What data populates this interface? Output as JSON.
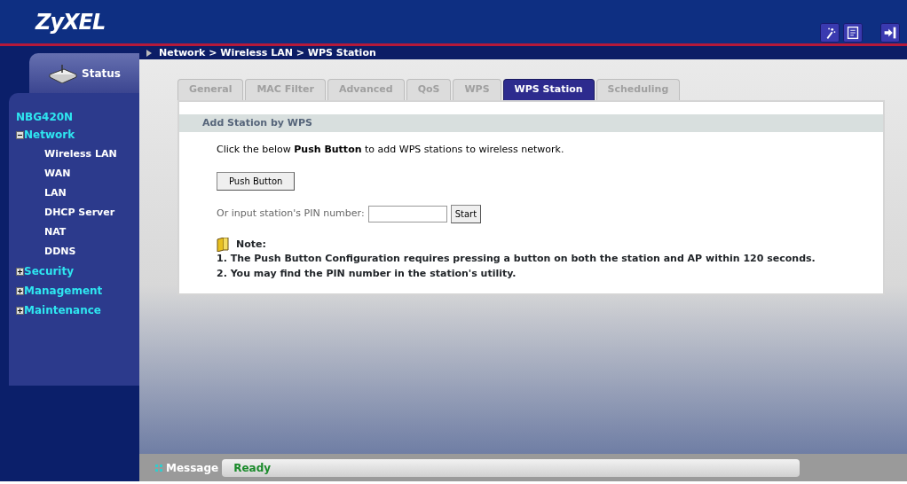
{
  "header": {
    "logo": "ZyXEL"
  },
  "sidebar": {
    "status_tab": "Status",
    "device": "NBG420N",
    "tree": [
      {
        "label": "Network",
        "expanded": true,
        "children": [
          {
            "label": "Wireless LAN"
          },
          {
            "label": "WAN"
          },
          {
            "label": "LAN"
          },
          {
            "label": "DHCP Server"
          },
          {
            "label": "NAT"
          },
          {
            "label": "DDNS"
          }
        ]
      },
      {
        "label": "Security",
        "expanded": false
      },
      {
        "label": "Management",
        "expanded": false
      },
      {
        "label": "Maintenance",
        "expanded": false
      }
    ]
  },
  "breadcrumb": "Network > Wireless LAN > WPS Station",
  "tabs": [
    {
      "label": "General",
      "selected": false
    },
    {
      "label": "MAC Filter",
      "selected": false
    },
    {
      "label": "Advanced",
      "selected": false
    },
    {
      "label": "QoS",
      "selected": false
    },
    {
      "label": "WPS",
      "selected": false
    },
    {
      "label": "WPS Station",
      "selected": true
    },
    {
      "label": "Scheduling",
      "selected": false
    }
  ],
  "panel": {
    "title": "Add Station by WPS",
    "intro": "Click the below **Push Button** to add WPS stations to wireless network.",
    "push_button": "Push Button",
    "pin_label": "Or input station's PIN number:",
    "start_button": "Start",
    "note_title": "Note:",
    "notes": [
      "1. The Push Button Configuration requires pressing a button on both the station and AP within 120 seconds.",
      "2. You may find the PIN number in the station's utility."
    ]
  },
  "status_bar": {
    "label": "Message",
    "value": "Ready"
  }
}
